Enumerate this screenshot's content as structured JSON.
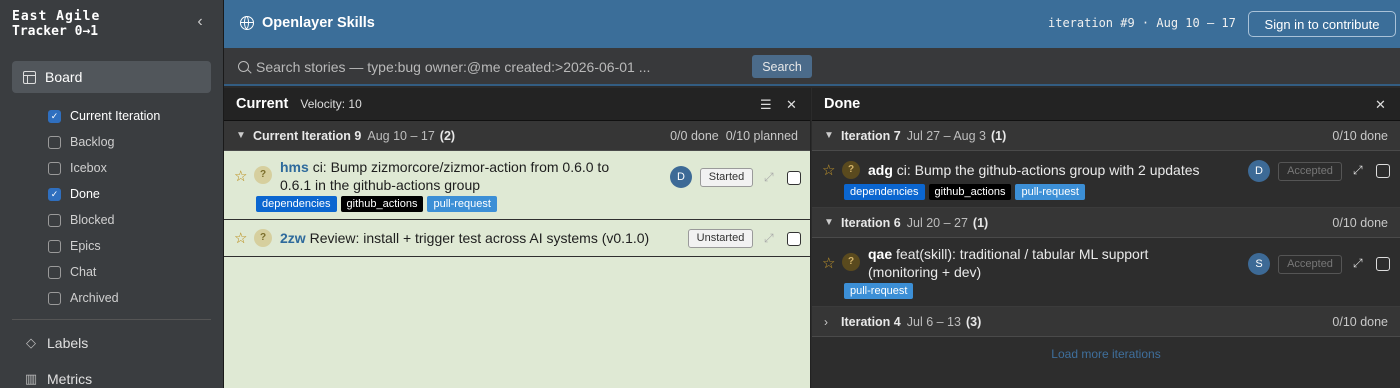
{
  "sidebar": {
    "brand_line1": "East Agile",
    "brand_line2": "Tracker 0→1",
    "collapse_icon": "‹",
    "board_label": "Board",
    "filters": [
      {
        "label": "Current Iteration",
        "checked": true
      },
      {
        "label": "Backlog",
        "checked": false
      },
      {
        "label": "Icebox",
        "checked": false
      },
      {
        "label": "Done",
        "checked": true
      },
      {
        "label": "Blocked",
        "checked": false
      },
      {
        "label": "Epics",
        "checked": false
      },
      {
        "label": "Chat",
        "checked": false
      },
      {
        "label": "Archived",
        "checked": false
      }
    ],
    "labels_label": "Labels",
    "metrics_label": "Metrics"
  },
  "header": {
    "title": "Openlayer Skills",
    "iteration_info": "iteration #9 · Aug 10 – 17",
    "signin_label": "Sign in to contribute"
  },
  "search": {
    "placeholder": "Search stories — type:bug owner:@me created:>2026-06-01 ...",
    "button_label": "Search"
  },
  "current_panel": {
    "title": "Current",
    "velocity": "Velocity: 10",
    "iteration": {
      "name": "Current Iteration 9",
      "dates": "Aug 10 – 17",
      "count": "(2)",
      "summary": "0/0 done  0/10 planned"
    },
    "stories": [
      {
        "id": "hms",
        "title_line1": "ci: Bump zizmorcore/zizmor-action from 0.6.0 to",
        "title_line2": "0.6.1 in the github-actions group",
        "avatar": "D",
        "state": "Started",
        "tags": [
          "dependencies",
          "github_actions",
          "pull-request"
        ]
      },
      {
        "id": "2zw",
        "title_line1": "Review: install + trigger test across AI systems (v0.1.0)",
        "state": "Unstarted"
      }
    ]
  },
  "done_panel": {
    "title": "Done",
    "iterations": [
      {
        "name": "Iteration 7",
        "dates": "Jul 27 – Aug 3",
        "count": "(1)",
        "summary": "0/10 done"
      },
      {
        "name": "Iteration 6",
        "dates": "Jul 20 – 27",
        "count": "(1)",
        "summary": "0/10 done"
      },
      {
        "name": "Iteration 4",
        "dates": "Jul 6 – 13",
        "count": "(3)",
        "summary": "0/10 done"
      }
    ],
    "stories": [
      {
        "id": "adg",
        "title_line1": "ci: Bump the github-actions group with 2 updates",
        "avatar": "D",
        "state": "Accepted",
        "tags": [
          "dependencies",
          "github_actions",
          "pull-request"
        ]
      },
      {
        "id": "qae",
        "title_line1": "feat(skill): traditional / tabular ML support",
        "title_line2": "(monitoring + dev)",
        "avatar": "S",
        "state": "Accepted",
        "tags": [
          "pull-request"
        ]
      }
    ],
    "load_more": "Load more iterations"
  },
  "glyphs": {
    "star": "☆",
    "question": "?",
    "close": "✕",
    "expand": "⤢",
    "check": "✓",
    "chev_down": "⌄",
    "chev_right": "›"
  }
}
